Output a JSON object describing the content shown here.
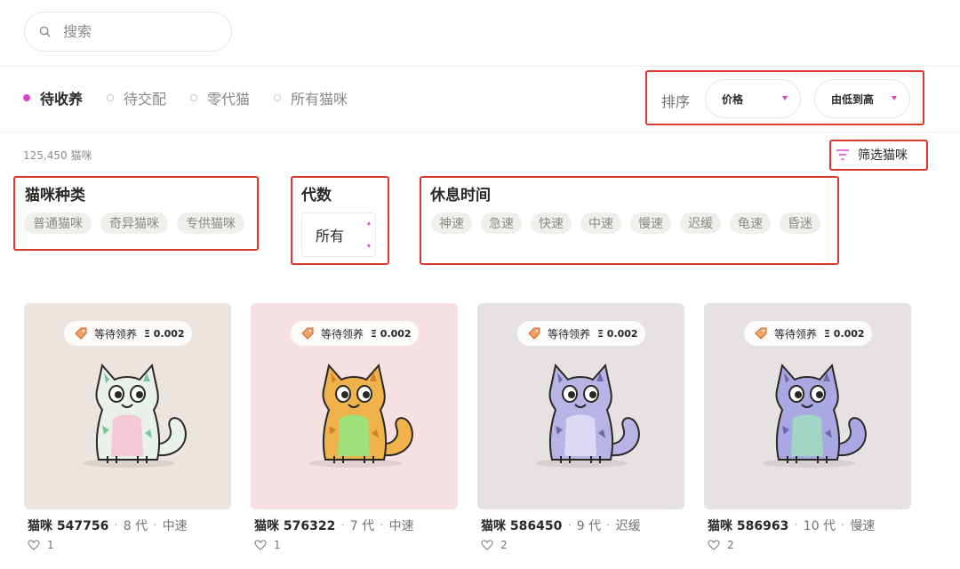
{
  "search": {
    "placeholder": "搜索"
  },
  "tabs": [
    {
      "label": "待收养",
      "active": true
    },
    {
      "label": "待交配",
      "active": false
    },
    {
      "label": "零代猫",
      "active": false
    },
    {
      "label": "所有猫咪",
      "active": false
    }
  ],
  "sort": {
    "label": "排序",
    "field": "价格",
    "order": "由低到高"
  },
  "count": "125,450 猫咪",
  "filter_button": "筛选猫咪",
  "filters": {
    "breed": {
      "title": "猫咪种类",
      "options": [
        "普通猫咪",
        "奇异猫咪",
        "专供猫咪"
      ]
    },
    "generation": {
      "title": "代数",
      "value": "所有"
    },
    "cooldown": {
      "title": "休息时间",
      "options": [
        "神速",
        "急速",
        "快速",
        "中速",
        "慢速",
        "迟缓",
        "龟速",
        "昏迷"
      ]
    }
  },
  "cards": [
    {
      "badge": "等待领养",
      "price": "Ξ 0.002",
      "name": "猫咪 547756",
      "gen": "8 代",
      "speed": "中速",
      "likes": "1",
      "bg": "#ece4de",
      "body": "#e8f2ea",
      "spots": "#7cc59a",
      "belly": "#f4c8d4"
    },
    {
      "badge": "等待领养",
      "price": "Ξ 0.002",
      "name": "猫咪 576322",
      "gen": "7 代",
      "speed": "中速",
      "likes": "1",
      "bg": "#f7e0e2",
      "body": "#f0b24a",
      "spots": "#d47f2a",
      "belly": "#9ee07a"
    },
    {
      "badge": "等待领养",
      "price": "Ξ 0.002",
      "name": "猫咪 586450",
      "gen": "9 代",
      "speed": "迟缓",
      "likes": "2",
      "bg": "#e6e2e2",
      "body": "#b9b4e6",
      "spots": "#6f6aa8",
      "belly": "#dcd9f4"
    },
    {
      "badge": "等待领养",
      "price": "Ξ 0.002",
      "name": "猫咪 586963",
      "gen": "10 代",
      "speed": "慢速",
      "likes": "2",
      "bg": "#e6e2e2",
      "body": "#a9a8e2",
      "spots": "#6f6aa8",
      "belly": "#9fd6c4"
    }
  ],
  "colors": {
    "accent": "#e040c8",
    "highlight_box": "#d9382f"
  }
}
